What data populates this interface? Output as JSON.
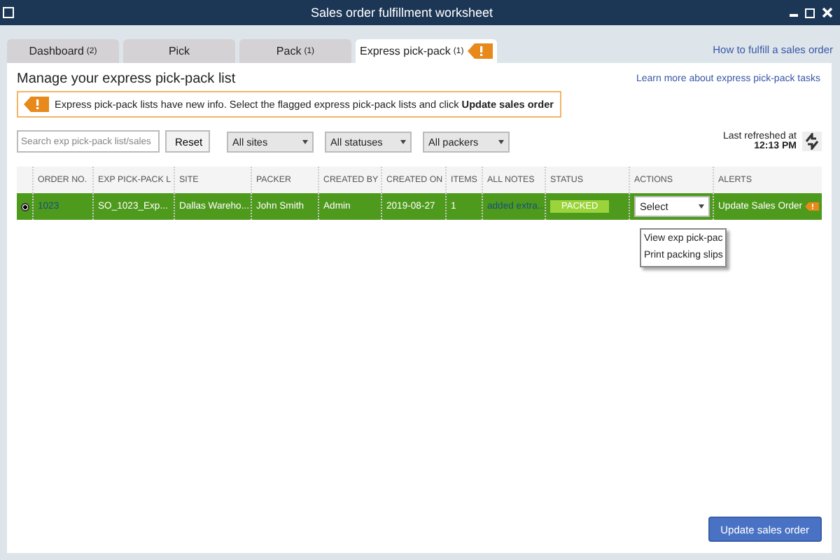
{
  "window": {
    "title": "Sales order fulfillment worksheet"
  },
  "tabs": [
    {
      "label": "Dashboard",
      "count": "(2)",
      "selected": false,
      "flagged": false
    },
    {
      "label": "Pick",
      "selected": false,
      "flagged": false
    },
    {
      "label": "Pack",
      "count": "(1)",
      "selected": false,
      "flagged": false
    },
    {
      "label": "Express pick-pack",
      "count": "(1)",
      "selected": true,
      "flagged": true
    }
  ],
  "help_link": "How to fulfill a sales order",
  "heading": "Manage your express pick-pack list",
  "learn_link": "Learn more about express pick-pack tasks",
  "notice": "Express pick-pack lists have new info. Select the flagged express pick-pack lists and click **Update sales order**",
  "filters": {
    "search": {
      "placeholder": "Search exp pick-pack list/sales"
    },
    "reset": "Reset",
    "dropdowns": [
      "All sites",
      "All statuses",
      "All packers"
    ]
  },
  "refresh": {
    "label": "Last refreshed at",
    "time": "12:13 PM"
  },
  "table": {
    "columns": [
      "ORDER NO.",
      "EXP PICK-PACK L",
      "SITE",
      "PACKER",
      "CREATED BY",
      "CREATED ON",
      "ITEMS",
      "ALL NOTES",
      "STATUS",
      "ACTIONS",
      "ALERTS"
    ],
    "rows": [
      {
        "selected": true,
        "order_no": "1023",
        "list": "SO_1023_Exp...",
        "site": "Dallas Wareho...",
        "packer": "John Smith",
        "created_by": "Admin",
        "created_on": "2019-08-27",
        "items": "1",
        "notes": "added extra...",
        "status": "PACKED",
        "action": "Select",
        "alert": "Update Sales Order",
        "flagged": true
      }
    ]
  },
  "action_menu": [
    "View exp pick-pac",
    "Print packing slips"
  ],
  "update_button": "Update sales order"
}
